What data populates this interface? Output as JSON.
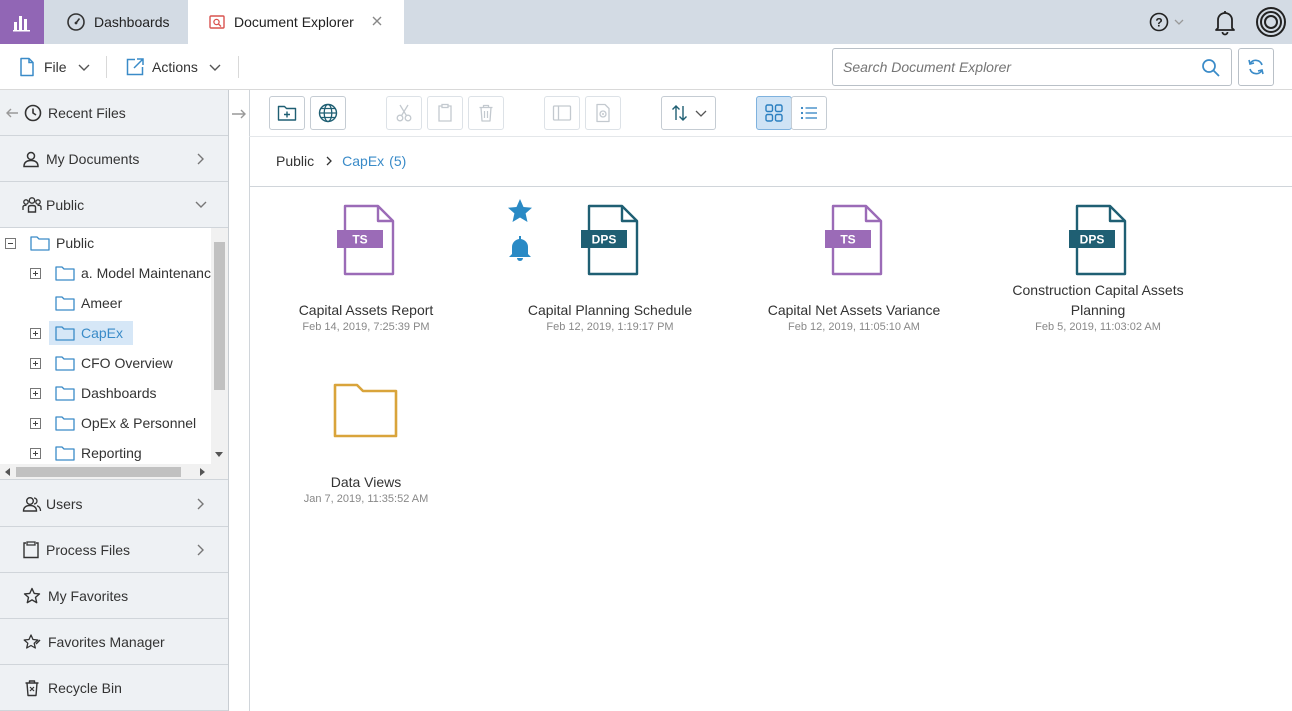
{
  "tabs": {
    "dashboards": "Dashboards",
    "document_explorer": "Document Explorer"
  },
  "menubar": {
    "file": "File",
    "actions": "Actions",
    "search_placeholder": "Search Document Explorer"
  },
  "sidebar": {
    "recent_files": "Recent Files",
    "my_documents": "My Documents",
    "public": "Public",
    "users": "Users",
    "process_files": "Process Files",
    "my_favorites": "My Favorites",
    "favorites_manager": "Favorites Manager",
    "recycle_bin": "Recycle Bin"
  },
  "tree": {
    "root": "Public",
    "items": [
      {
        "label": "a. Model Maintenance"
      },
      {
        "label": "Ameer"
      },
      {
        "label": "CapEx"
      },
      {
        "label": "CFO Overview"
      },
      {
        "label": "Dashboards"
      },
      {
        "label": "OpEx & Personnel"
      },
      {
        "label": "Reporting"
      }
    ],
    "selected": "CapEx"
  },
  "breadcrumb": {
    "root": "Public",
    "current": "CapEx",
    "count": "(5)"
  },
  "documents": [
    {
      "name": "Capital Assets Report",
      "date": "Feb 14, 2019, 7:25:39 PM",
      "type": "TS"
    },
    {
      "name": "Capital Planning Schedule",
      "date": "Feb 12, 2019, 1:19:17 PM",
      "type": "DPS"
    },
    {
      "name": "Capital Net Assets Variance",
      "date": "Feb 12, 2019, 11:05:10 AM",
      "type": "TS"
    },
    {
      "name_line1": "Construction Capital Assets",
      "name_line2": "Planning",
      "date": "Feb 5, 2019, 11:03:02 AM",
      "type": "DPS"
    },
    {
      "name": "Data Views",
      "date": "Jan 7, 2019, 11:35:52 AM",
      "type": "folder"
    }
  ],
  "colors": {
    "brand_purple": "#9166b5",
    "ts_purple": "#9b6bb7",
    "dps_teal": "#1f5f73",
    "folder_gold": "#d9a43b",
    "accent_blue": "#3a8bc8"
  }
}
